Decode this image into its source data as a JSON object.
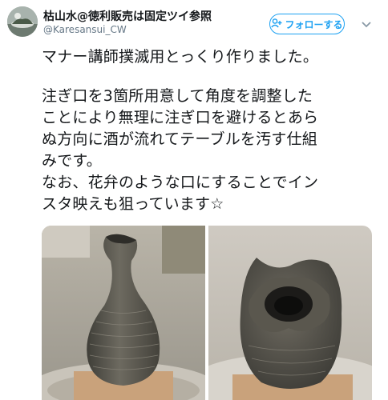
{
  "user": {
    "display_name": "枯山水@徳利販売は固定ツイ参照",
    "handle": "@Karesansui_CW"
  },
  "follow_button": {
    "label": "フォローする"
  },
  "tweet": {
    "paragraph1": "マナー講師撲滅用とっくり作りました。",
    "paragraph2_lines": [
      "注ぎ口を3箇所用意して角度を調整した",
      "ことにより無理に注ぎ口を避けるとあら",
      "ぬ方向に酒が流れてテーブルを汚す仕組",
      "みです。",
      "なお、花弁のような口にすることでイン",
      "スタ映えも狙っています☆"
    ]
  },
  "colors": {
    "accent": "#1da1f2",
    "text": "#14171a",
    "secondary_text": "#657786"
  },
  "icons": {
    "follow": "person-plus-icon",
    "menu": "chevron-down-icon"
  }
}
